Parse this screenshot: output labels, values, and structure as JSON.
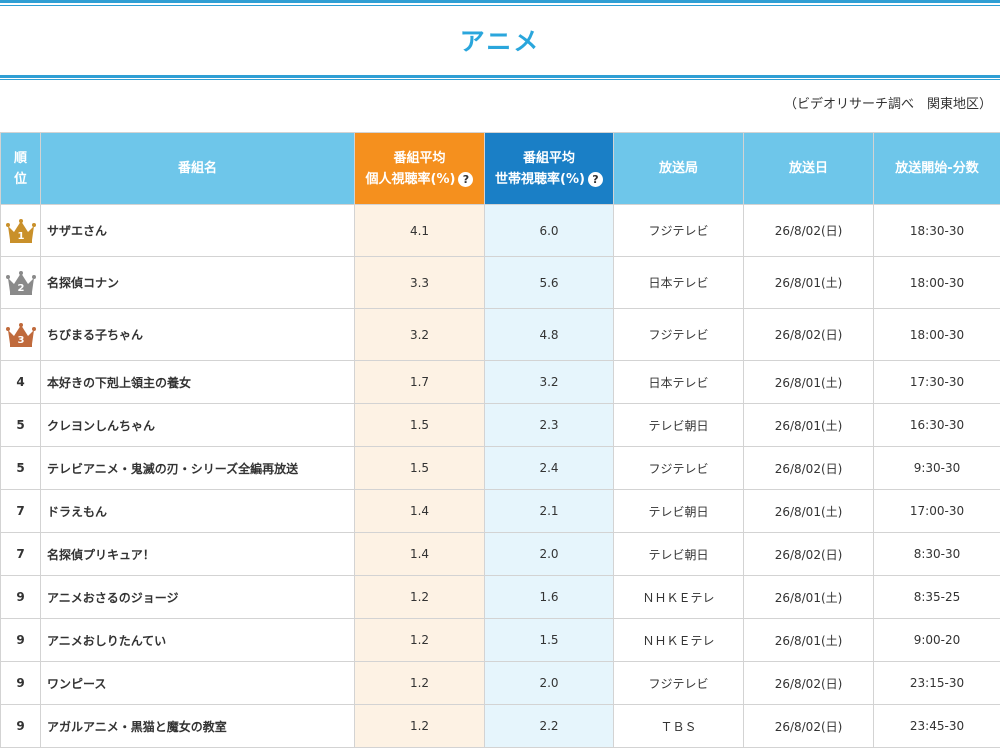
{
  "header": {
    "title": "アニメ"
  },
  "note": "（ビデオリサーチ調べ　関東地区）",
  "colors": {
    "accent": "#2aa6dc",
    "personal": "#f5901e",
    "household": "#1a7fc6",
    "header_bg": "#6ec6ea",
    "gold": "#c9902a",
    "silver": "#8a8a8a",
    "bronze": "#c06a3c"
  },
  "table": {
    "headers": {
      "rank": [
        "順",
        "位"
      ],
      "name": "番組名",
      "personal": [
        "番組平均",
        "個人視聴率(%)"
      ],
      "household": [
        "番組平均",
        "世帯視聴率(%)"
      ],
      "station": "放送局",
      "date": "放送日",
      "time": "放送開始-分数"
    },
    "help_icon": "?",
    "rows": [
      {
        "rank": "1",
        "name": "サザエさん",
        "personal": "4.1",
        "household": "6.0",
        "station": "フジテレビ",
        "date": "26/8/02(日)",
        "time": "18:30-30",
        "crown": "gold"
      },
      {
        "rank": "2",
        "name": "名探偵コナン",
        "personal": "3.3",
        "household": "5.6",
        "station": "日本テレビ",
        "date": "26/8/01(土)",
        "time": "18:00-30",
        "crown": "silver"
      },
      {
        "rank": "3",
        "name": "ちびまる子ちゃん",
        "personal": "3.2",
        "household": "4.8",
        "station": "フジテレビ",
        "date": "26/8/02(日)",
        "time": "18:00-30",
        "crown": "bronze"
      },
      {
        "rank": "4",
        "name": "本好きの下剋上領主の養女",
        "personal": "1.7",
        "household": "3.2",
        "station": "日本テレビ",
        "date": "26/8/01(土)",
        "time": "17:30-30"
      },
      {
        "rank": "5",
        "name": "クレヨンしんちゃん",
        "personal": "1.5",
        "household": "2.3",
        "station": "テレビ朝日",
        "date": "26/8/01(土)",
        "time": "16:30-30"
      },
      {
        "rank": "5",
        "name": "テレビアニメ・鬼滅の刃・シリーズ全編再放送",
        "personal": "1.5",
        "household": "2.4",
        "station": "フジテレビ",
        "date": "26/8/02(日)",
        "time": "9:30-30"
      },
      {
        "rank": "7",
        "name": "ドラえもん",
        "personal": "1.4",
        "household": "2.1",
        "station": "テレビ朝日",
        "date": "26/8/01(土)",
        "time": "17:00-30"
      },
      {
        "rank": "7",
        "name": "名探偵プリキュア！",
        "personal": "1.4",
        "household": "2.0",
        "station": "テレビ朝日",
        "date": "26/8/02(日)",
        "time": "8:30-30"
      },
      {
        "rank": "9",
        "name": "アニメおさるのジョージ",
        "personal": "1.2",
        "household": "1.6",
        "station": "ＮＨＫＥテレ",
        "date": "26/8/01(土)",
        "time": "8:35-25"
      },
      {
        "rank": "9",
        "name": "アニメおしりたんてい",
        "personal": "1.2",
        "household": "1.5",
        "station": "ＮＨＫＥテレ",
        "date": "26/8/01(土)",
        "time": "9:00-20"
      },
      {
        "rank": "9",
        "name": "ワンピース",
        "personal": "1.2",
        "household": "2.0",
        "station": "フジテレビ",
        "date": "26/8/02(日)",
        "time": "23:15-30"
      },
      {
        "rank": "9",
        "name": "アガルアニメ・黒猫と魔女の教室",
        "personal": "1.2",
        "household": "2.2",
        "station": "ＴＢＳ",
        "date": "26/8/02(日)",
        "time": "23:45-30"
      }
    ]
  }
}
